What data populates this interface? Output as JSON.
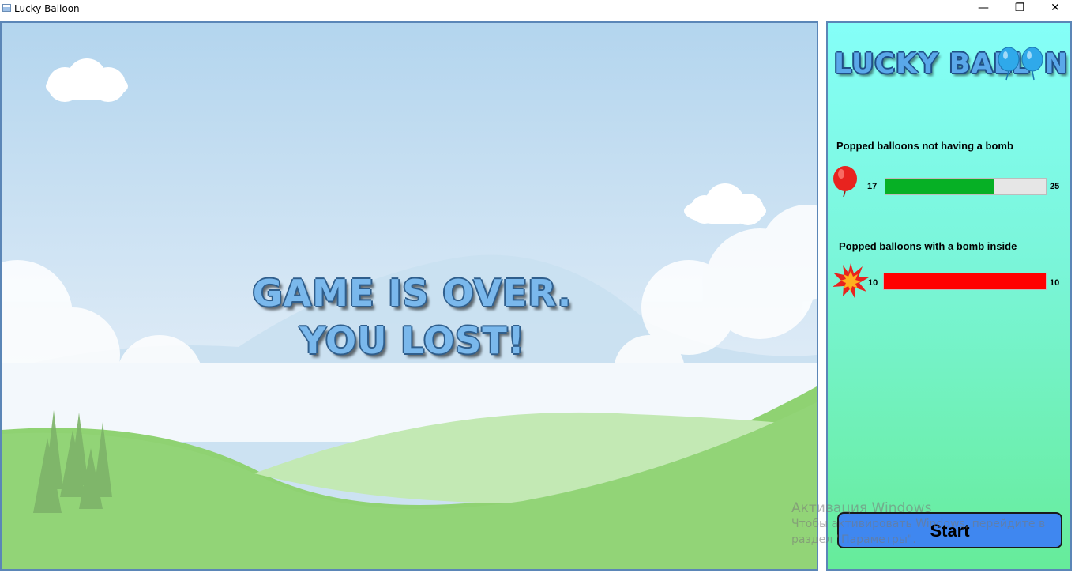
{
  "window": {
    "title": "Lucky Balloon",
    "controls": {
      "minimize": "—",
      "maximize": "❐",
      "close": "✕"
    }
  },
  "game": {
    "message": "GAME IS OVER. YOU LOST!"
  },
  "panel": {
    "logo_text_left": "LUCKY BALL",
    "logo_text_right": "N",
    "safe_label": "Popped balloons not having a bomb",
    "safe_current": "17",
    "safe_max": "25",
    "safe_progress": 0.68,
    "bomb_label": "Popped balloons with a bomb inside",
    "bomb_current": "10",
    "bomb_max": "10",
    "bomb_progress": 1.0,
    "start_label": "Start",
    "colors": {
      "safe_bar": "#06b025",
      "bomb_bar": "#ff0000",
      "start_button": "#3f87f0"
    }
  },
  "watermark": {
    "line1": "Активация Windows",
    "line2": "Чтобы активировать Windows, перейдите в",
    "line3": "раздел \"Параметры\"."
  }
}
